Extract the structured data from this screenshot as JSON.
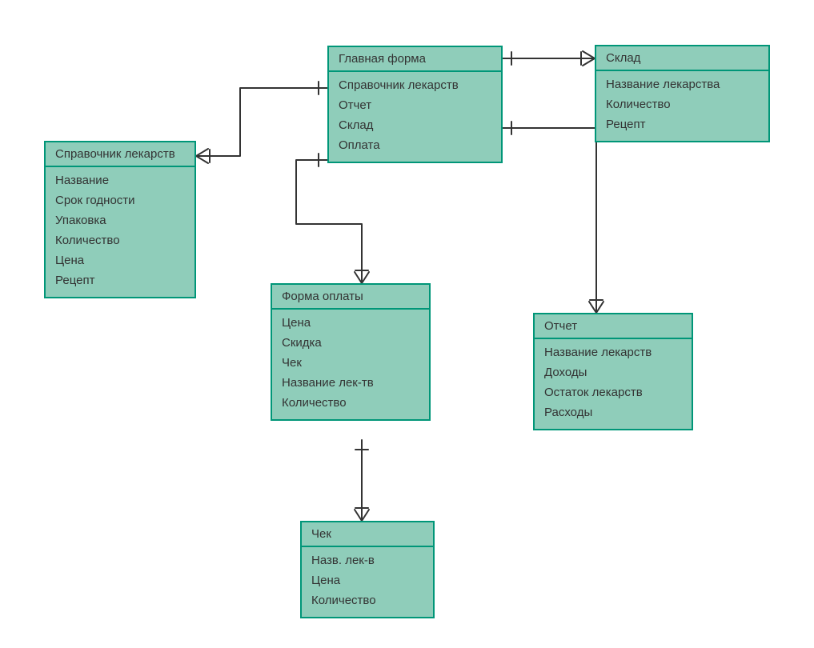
{
  "chart_data": {
    "type": "table",
    "title": "ER diagram",
    "entities": [
      {
        "name": "Главная форма",
        "attributes": [
          "Справочник лекарств",
          "Отчет",
          "Склад",
          "Оплата"
        ]
      },
      {
        "name": "Склад",
        "attributes": [
          "Название лекарства",
          "Количество",
          "Рецепт"
        ]
      },
      {
        "name": "Справочник лекарств",
        "attributes": [
          "Название",
          "Срок годности",
          "Упаковка",
          "Количество",
          "Цена",
          "Рецепт"
        ]
      },
      {
        "name": "Форма оплаты",
        "attributes": [
          "Цена",
          "Скидка",
          "Чек",
          "Название лек-тв",
          "Количество"
        ]
      },
      {
        "name": "Отчет",
        "attributes": [
          "Название лекарств",
          "Доходы",
          "Остаток лекарств",
          "Расходы"
        ]
      },
      {
        "name": "Чек",
        "attributes": [
          "Назв. лек-в",
          "Цена",
          "Количество"
        ]
      }
    ],
    "relations": [
      {
        "from": "Главная форма",
        "to": "Склад",
        "type": "one-to-many"
      },
      {
        "from": "Главная форма",
        "to": "Справочник лекарств",
        "type": "one-to-many"
      },
      {
        "from": "Главная форма",
        "to": "Форма оплаты",
        "type": "one-to-many"
      },
      {
        "from": "Главная форма",
        "to": "Отчет",
        "type": "one-to-many"
      },
      {
        "from": "Форма оплаты",
        "to": "Чек",
        "type": "one-to-many"
      }
    ]
  },
  "entities": {
    "main": {
      "title": "Главная форма",
      "attrs": [
        "Справочник лекарств",
        "Отчет",
        "Склад",
        "Оплата"
      ]
    },
    "sklad": {
      "title": "Склад",
      "attrs": [
        "Название лекарства",
        "Количество",
        "Рецепт"
      ]
    },
    "sprav": {
      "title": "Справочник лекарств",
      "attrs": [
        "Название",
        "Срок годности",
        "Упаковка",
        "Количество",
        "Цена",
        "Рецепт"
      ]
    },
    "oplata": {
      "title": "Форма оплаты",
      "attrs": [
        "Цена",
        "Скидка",
        "Чек",
        "Название лек-тв",
        "Количество"
      ]
    },
    "otchet": {
      "title": "Отчет",
      "attrs": [
        "Название лекарств",
        "Доходы",
        "Остаток лекарств",
        "Расходы"
      ]
    },
    "chek": {
      "title": "Чек",
      "attrs": [
        "Назв. лек-в",
        "Цена",
        "Количество"
      ]
    }
  }
}
